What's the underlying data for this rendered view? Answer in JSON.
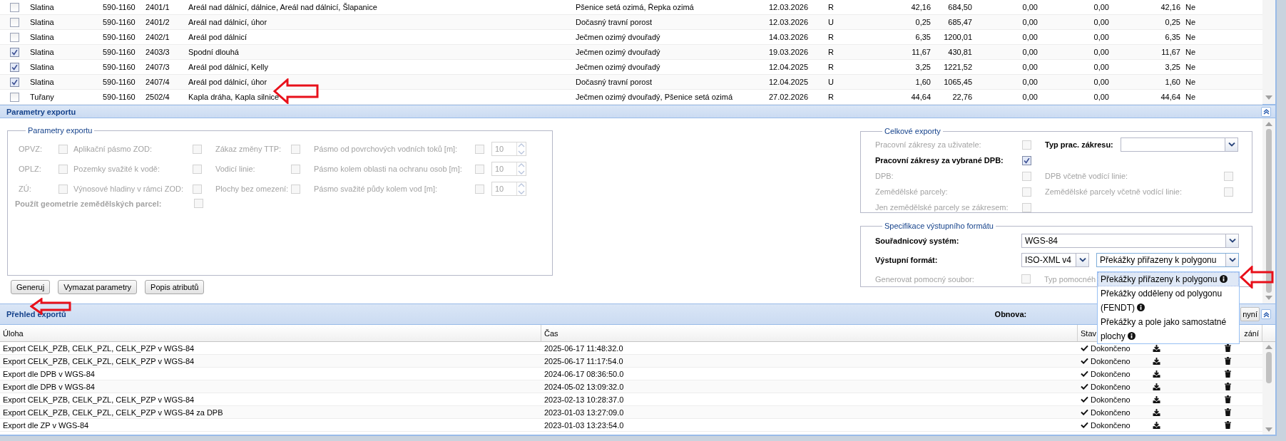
{
  "parcels_table": {
    "rows": [
      {
        "checked": false,
        "cells": [
          "Slatina",
          "590-1160",
          "2401/1",
          "Areál nad dálnicí, dálnice, Areál nad dálnicí, Šlapanice",
          "Pšenice setá ozimá, Řepka ozimá",
          "12.03.2026",
          "R",
          "42,16",
          "684,50",
          "0,00",
          "0,00",
          "42,16",
          "Ne"
        ]
      },
      {
        "checked": false,
        "cells": [
          "Slatina",
          "590-1160",
          "2401/2",
          "Areál nad dálnicí, úhor",
          "Dočasný travní porost",
          "12.03.2026",
          "U",
          "0,25",
          "685,47",
          "0,00",
          "0,00",
          "0,25",
          "Ne"
        ]
      },
      {
        "checked": false,
        "cells": [
          "Slatina",
          "590-1160",
          "2402/1",
          "Areál pod dálnicí",
          "Ječmen ozimý dvouřadý",
          "14.03.2026",
          "R",
          "6,35",
          "1200,01",
          "0,00",
          "0,00",
          "6,35",
          "Ne"
        ]
      },
      {
        "checked": true,
        "cells": [
          "Slatina",
          "590-1160",
          "2403/3",
          "Spodní dlouhá",
          "Ječmen ozimý dvouřadý",
          "19.03.2026",
          "R",
          "11,67",
          "430,81",
          "0,00",
          "0,00",
          "11,67",
          "Ne"
        ]
      },
      {
        "checked": true,
        "cells": [
          "Slatina",
          "590-1160",
          "2407/3",
          "Areál pod dálnicí, Kelly",
          "Ječmen ozimý dvouřadý",
          "12.04.2025",
          "R",
          "3,25",
          "1221,52",
          "0,00",
          "0,00",
          "3,25",
          "Ne"
        ]
      },
      {
        "checked": true,
        "cells": [
          "Slatina",
          "590-1160",
          "2407/4",
          "Areál pod dálnicí, úhor",
          "Dočasný travní porost",
          "12.04.2025",
          "U",
          "1,60",
          "1065,45",
          "0,00",
          "0,00",
          "1,60",
          "Ne"
        ]
      },
      {
        "checked": false,
        "cells": [
          "Tuřany",
          "590-1160",
          "2502/4",
          "Kapla dráha, Kapla silnice",
          "Ječmen ozimý dvouřadý, Pšenice setá ozimá",
          "27.02.2026",
          "R",
          "44,64",
          "22,76",
          "0,00",
          "0,00",
          "44,64",
          "Ne"
        ]
      }
    ]
  },
  "params_panel": {
    "title": "Parametry exportu"
  },
  "export_params": {
    "legend": "Parametry exportu",
    "rows": [
      {
        "options": [
          {
            "label": "OPVZ:",
            "checked": false,
            "disabled": true
          },
          {
            "label": "Aplikační pásmo ZOD:",
            "checked": false,
            "disabled": true
          },
          {
            "label": "Zákaz změny TTP:",
            "checked": false,
            "disabled": true
          },
          {
            "label": "Pásmo od povrchových vodních toků [m]:",
            "checked": false,
            "disabled": true
          }
        ],
        "distance": "10"
      },
      {
        "options": [
          {
            "label": "OPLZ:",
            "checked": false,
            "disabled": true
          },
          {
            "label": "Pozemky svažité k vodě:",
            "checked": false,
            "disabled": true
          },
          {
            "label": "Vodicí linie:",
            "checked": false,
            "disabled": true
          },
          {
            "label": "Pásmo kolem oblasti na ochranu osob [m]:",
            "checked": false,
            "disabled": true
          }
        ],
        "distance": "10"
      },
      {
        "options": [
          {
            "label": "ZÚ:",
            "checked": false,
            "disabled": true
          },
          {
            "label": "Výnosové hladiny v rámci ZOD:",
            "checked": false,
            "disabled": true
          },
          {
            "label": "Plochy bez omezení:",
            "checked": false,
            "disabled": true
          },
          {
            "label": "Pásmo svažité půdy kolem vod [m]:",
            "checked": false,
            "disabled": true
          }
        ],
        "distance": "10"
      }
    ],
    "geometry": {
      "label": "Použít geometrie zemědělských parcel:",
      "checked": false,
      "disabled": true
    }
  },
  "buttons": [
    "Generuj",
    "Vymazat parametry",
    "Popis atributů"
  ],
  "total_exports": {
    "legend": "Celkové exporty",
    "rows": [
      {
        "items": [
          {
            "kind": "checkbox",
            "label": "Pracovní zákresy za uživatele:",
            "checked": false,
            "disabled": true
          },
          {
            "kind": "select",
            "label": "Typ prac. zákresu:"
          }
        ]
      },
      {
        "items": [
          {
            "kind": "checkbox",
            "label": "Pracovní zákresy za vybrané DPB:",
            "checked": true,
            "disabled": false
          }
        ]
      },
      {
        "items": [
          {
            "kind": "checkbox",
            "label": "DPB:",
            "checked": false,
            "disabled": true
          },
          {
            "kind": "checkbox",
            "label": "DPB včetně vodící linie:",
            "checked": false,
            "disabled": true
          }
        ]
      },
      {
        "items": [
          {
            "kind": "checkbox",
            "label": "Zemědělské parcely:",
            "checked": false,
            "disabled": true
          },
          {
            "kind": "checkbox",
            "label": "Zemědělské parcely včetně vodící linie:",
            "checked": false,
            "disabled": true
          }
        ]
      },
      {
        "items": [
          {
            "kind": "checkbox",
            "label": "Jen zemědělské parcely se zákresem:",
            "checked": false,
            "disabled": true
          }
        ]
      }
    ]
  },
  "output_spec": {
    "legend": "Specifikace výstupního formátu",
    "coordinate_system": {
      "label": "Souřadnicový systém:",
      "value": "WGS-84"
    },
    "output_format": {
      "label": "Výstupní formát:",
      "value": "ISO-XML v4",
      "variant": "Překážky přiřazeny k polygonu"
    },
    "helper_file": {
      "label": "Generovat pomocný soubor:",
      "checked": false,
      "disabled": true,
      "type_label": "Typ pomocnéh"
    }
  },
  "variant_dropdown": {
    "options": [
      {
        "label": "Překážky přiřazeny k polygonu",
        "selected": true
      },
      {
        "label": "Překážky odděleny od polygonu (FENDT)",
        "selected": false
      },
      {
        "label": "Překážky a pole jako samostatné plochy",
        "selected": false
      }
    ]
  },
  "exports_panel": {
    "title": "Přehled exportů",
    "refresh_label": "Obnova:",
    "refresh_button": "nyní",
    "columns": [
      "Úloha",
      "Čas",
      "Stav",
      "zání"
    ],
    "rows": [
      {
        "task": "Export CELK_PZB, CELK_PZL, CELK_PZP v WGS-84",
        "time": "2025-06-17 11:48:32.0",
        "status": "Dokončeno"
      },
      {
        "task": "Export CELK_PZB, CELK_PZL, CELK_PZP v WGS-84",
        "time": "2025-06-17 11:17:54.0",
        "status": "Dokončeno"
      },
      {
        "task": "Export dle DPB v WGS-84",
        "time": "2024-06-17 08:36:50.0",
        "status": "Dokončeno"
      },
      {
        "task": "Export dle DPB v WGS-84",
        "time": "2024-05-02 13:09:32.0",
        "status": "Dokončeno"
      },
      {
        "task": "Export CELK_PZB, CELK_PZL, CELK_PZP v WGS-84",
        "time": "2023-02-13 10:28:37.0",
        "status": "Dokončeno"
      },
      {
        "task": "Export CELK_PZB, CELK_PZL, CELK_PZP v WGS-84 za DPB",
        "time": "2023-01-03 13:27:09.0",
        "status": "Dokončeno"
      },
      {
        "task": "Export dle ZP v WGS-84",
        "time": "2023-01-03 13:23:54.0",
        "status": "Dokončeno"
      }
    ]
  }
}
